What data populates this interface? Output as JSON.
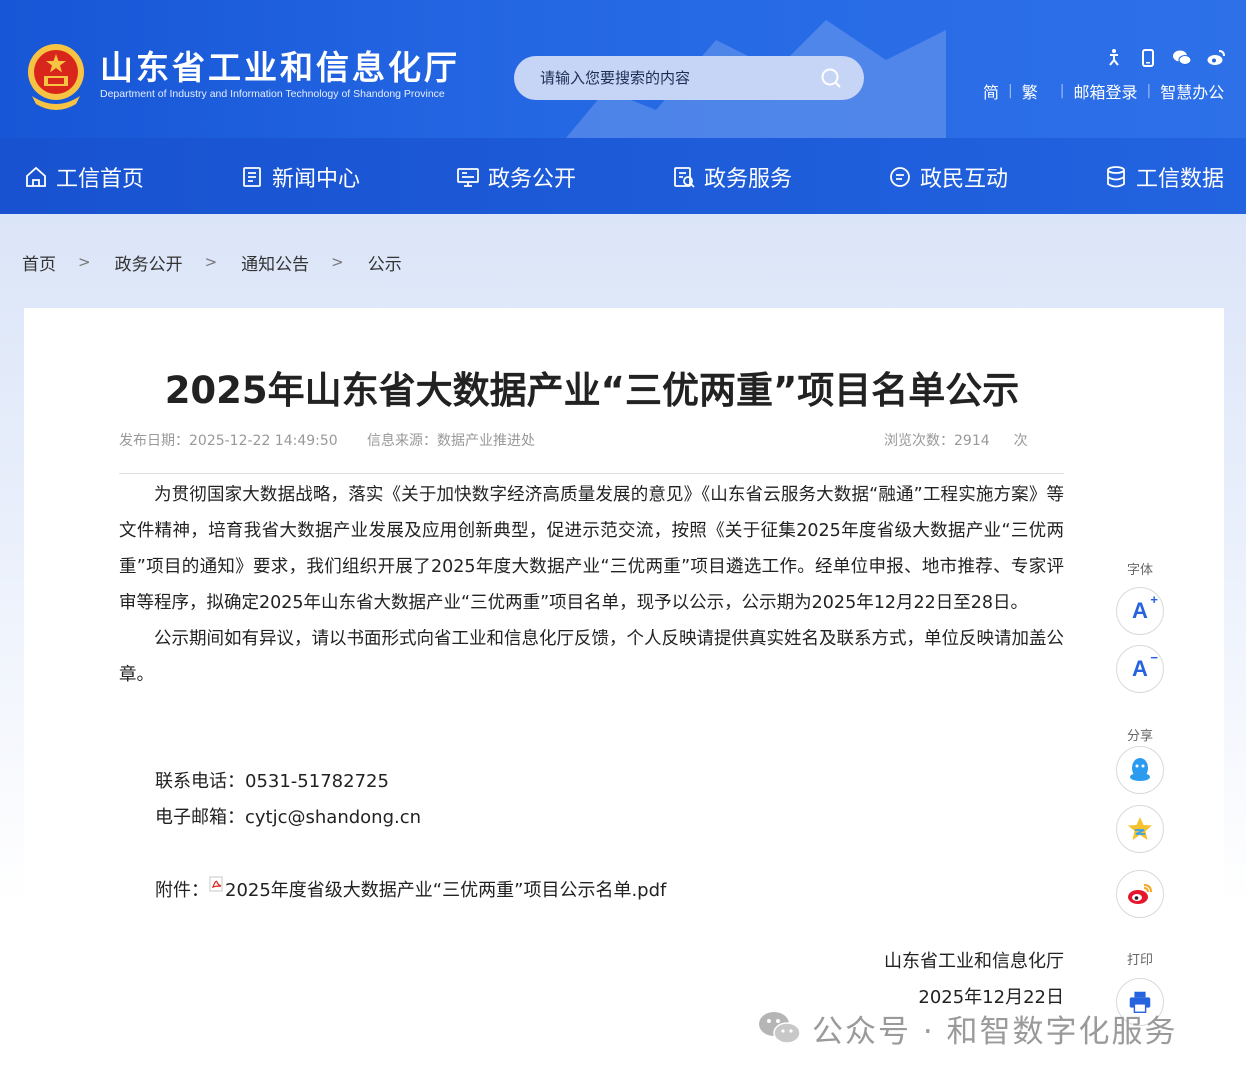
{
  "header": {
    "title": "山东省工业和信息化厅",
    "subtitle": "Department of Industry and Information Technology of Shandong Province",
    "search_placeholder": "请输入您要搜索的内容",
    "top_icons": [
      "accessibility-icon",
      "mobile-icon",
      "wechat-icon",
      "weibo-icon"
    ],
    "links": {
      "simplified": "简",
      "traditional": "繁",
      "mail_login": "邮箱登录",
      "smart_office": "智慧办公"
    }
  },
  "nav": {
    "items": [
      {
        "label": "工信首页",
        "icon": "home-icon"
      },
      {
        "label": "新闻中心",
        "icon": "news-icon"
      },
      {
        "label": "政务公开",
        "icon": "gov-open-icon"
      },
      {
        "label": "政务服务",
        "icon": "gov-service-icon"
      },
      {
        "label": "政民互动",
        "icon": "interaction-icon"
      },
      {
        "label": "工信数据",
        "icon": "database-icon"
      }
    ]
  },
  "breadcrumb": {
    "items": [
      "首页",
      "政务公开",
      "通知公告",
      "公示"
    ],
    "separator": ">"
  },
  "article": {
    "title": "2025年山东省大数据产业“三优两重”项目名单公示",
    "publish_label": "发布日期：",
    "publish_date": "2025-12-22 14:49:50",
    "source_label": "信息来源：",
    "source": "数据产业推进处",
    "views_label": "浏览次数：",
    "views": "2914",
    "views_unit": "次",
    "paragraphs": [
      "为贯彻国家大数据战略，落实《关于加快数字经济高质量发展的意见》《山东省云服务大数据“融通”工程实施方案》等文件精神，培育我省大数据产业发展及应用创新典型，促进示范交流，按照《关于征集2025年度省级大数据产业“三优两重”项目的通知》要求，我们组织开展了2025年度大数据产业“三优两重”项目遴选工作。经单位申报、地市推荐、专家评审等程序，拟确定2025年山东省大数据产业“三优两重”项目名单，现予以公示，公示期为2025年12月22日至28日。",
      "公示期间如有异议，请以书面形式向省工业和信息化厅反馈，个人反映请提供真实姓名及联系方式，单位反映请加盖公章。"
    ],
    "phone": "联系电话：0531-51782725",
    "email": "电子邮箱：cytjc@shandong.cn",
    "attach_label": "附件：",
    "attach_name": "2025年度省级大数据产业“三优两重”项目公示名单.pdf",
    "signature_org": "山东省工业和信息化厅",
    "signature_date": "2025年12月22日"
  },
  "side_tools": {
    "font_label": "字体",
    "font_increase": "A",
    "font_decrease": "A",
    "share_label": "分享",
    "print_label": "打印"
  },
  "watermark": "公众号 · 和智数字化服务",
  "colors": {
    "header_blue": "#2263e0",
    "accent_blue": "#2663de"
  }
}
